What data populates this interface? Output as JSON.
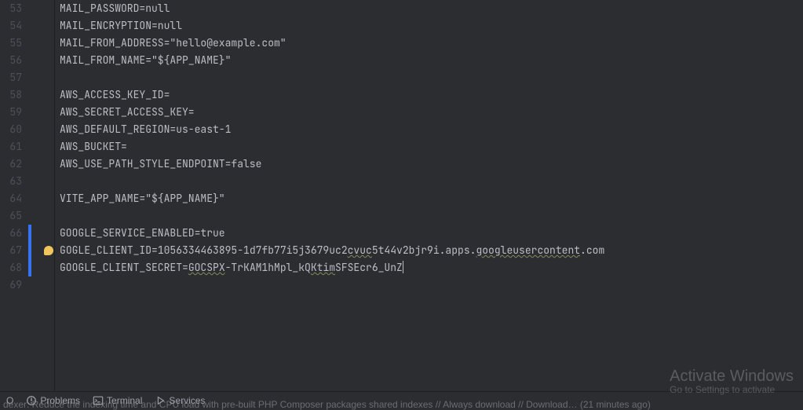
{
  "editor": {
    "lines": [
      {
        "n": 53,
        "text": "MAIL_PASSWORD=null"
      },
      {
        "n": 54,
        "text": "MAIL_ENCRYPTION=null"
      },
      {
        "n": 55,
        "text": "MAIL_FROM_ADDRESS=\"hello@example.com\""
      },
      {
        "n": 56,
        "text": "MAIL_FROM_NAME=\"${APP_NAME}\""
      },
      {
        "n": 57,
        "text": ""
      },
      {
        "n": 58,
        "text": "AWS_ACCESS_KEY_ID="
      },
      {
        "n": 59,
        "text": "AWS_SECRET_ACCESS_KEY="
      },
      {
        "n": 60,
        "text": "AWS_DEFAULT_REGION=us-east-1"
      },
      {
        "n": 61,
        "text": "AWS_BUCKET="
      },
      {
        "n": 62,
        "text": "AWS_USE_PATH_STYLE_ENDPOINT=false"
      },
      {
        "n": 63,
        "text": ""
      },
      {
        "n": 64,
        "text": "VITE_APP_NAME=\"${APP_NAME}\""
      },
      {
        "n": 65,
        "text": ""
      },
      {
        "n": 66,
        "text": "GOOGLE_SERVICE_ENABLED=true"
      },
      {
        "n": 67,
        "raw": true,
        "segments": [
          "G",
          "OGLE_CLIENT_ID=1056334463895-1d7fb77i5j3679uc2",
          {
            "t": "cvuc",
            "w": true
          },
          "5t44v2bjr9i.apps.",
          {
            "t": "googleusercontent",
            "w": true
          },
          ".com"
        ],
        "bulb": true
      },
      {
        "n": 68,
        "raw": true,
        "segments": [
          "GOOGLE_CLIENT_SECRET=",
          {
            "t": "GOCSPX",
            "w": true
          },
          "-TrKAM1hMpl_kQ",
          {
            "t": "Ktim",
            "w": true
          },
          "SFSEcr6_UnZ"
        ],
        "cursor": true
      },
      {
        "n": 69,
        "text": ""
      }
    ],
    "change_markers": [
      {
        "from": 66,
        "to": 68
      }
    ]
  },
  "statusbar": {
    "todo_label": "O",
    "problems_label": "Problems",
    "terminal_label": "Terminal",
    "services_label": "Services"
  },
  "hint_text": "dexer: Reduce the indexing time and CPU load with pre-built PHP Composer packages shared indexes // Always download // Download… (21 minutes ago)",
  "watermark": {
    "title": "Activate Windows",
    "subtitle": "Go to Settings to activate"
  }
}
